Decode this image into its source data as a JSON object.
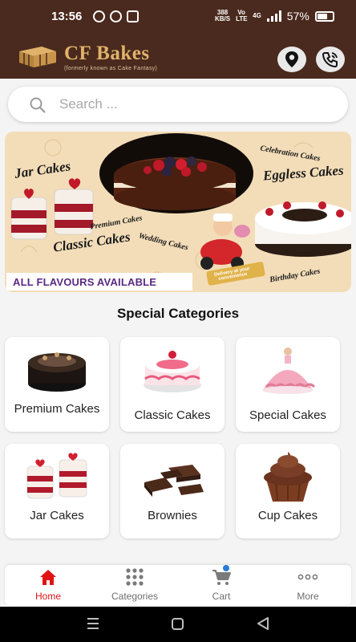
{
  "status_bar": {
    "time": "13:56",
    "net_speed": "388",
    "net_unit": "KB/S",
    "volte": "Vo LTE",
    "signal": "4G",
    "battery": "57%"
  },
  "header": {
    "brand": "CF Bakes",
    "tagline": "(formerly known as Cake Fantasy)",
    "location_icon": "location-pin-icon",
    "call_icon": "phone-call-icon"
  },
  "search": {
    "placeholder": "Search ..."
  },
  "banner": {
    "labels": [
      "Jar Cakes",
      "Premium Cakes",
      "Classic Cakes",
      "Wedding Cakes",
      "Celebration Cakes",
      "Eggless Cakes",
      "Birthday Cakes"
    ],
    "delivery": "Delivery at your convenience",
    "strip": "ALL FLAVOURS AVAILABLE"
  },
  "section": {
    "title": "Special Categories"
  },
  "categories": [
    {
      "label": "Premium Cakes"
    },
    {
      "label": "Classic Cakes"
    },
    {
      "label": "Special Cakes"
    },
    {
      "label": "Jar Cakes"
    },
    {
      "label": "Brownies"
    },
    {
      "label": "Cup Cakes"
    }
  ],
  "bottom_nav": [
    {
      "label": "Home",
      "icon": "home-icon",
      "active": true
    },
    {
      "label": "Categories",
      "icon": "grid-icon",
      "active": false
    },
    {
      "label": "Cart",
      "icon": "cart-icon",
      "active": false
    },
    {
      "label": "More",
      "icon": "more-dots-icon",
      "active": false
    }
  ],
  "colors": {
    "header_bg": "#4a2a1e",
    "brand": "#e0b26a",
    "active": "#e01414",
    "banner_bg": "#f3ddb8"
  }
}
